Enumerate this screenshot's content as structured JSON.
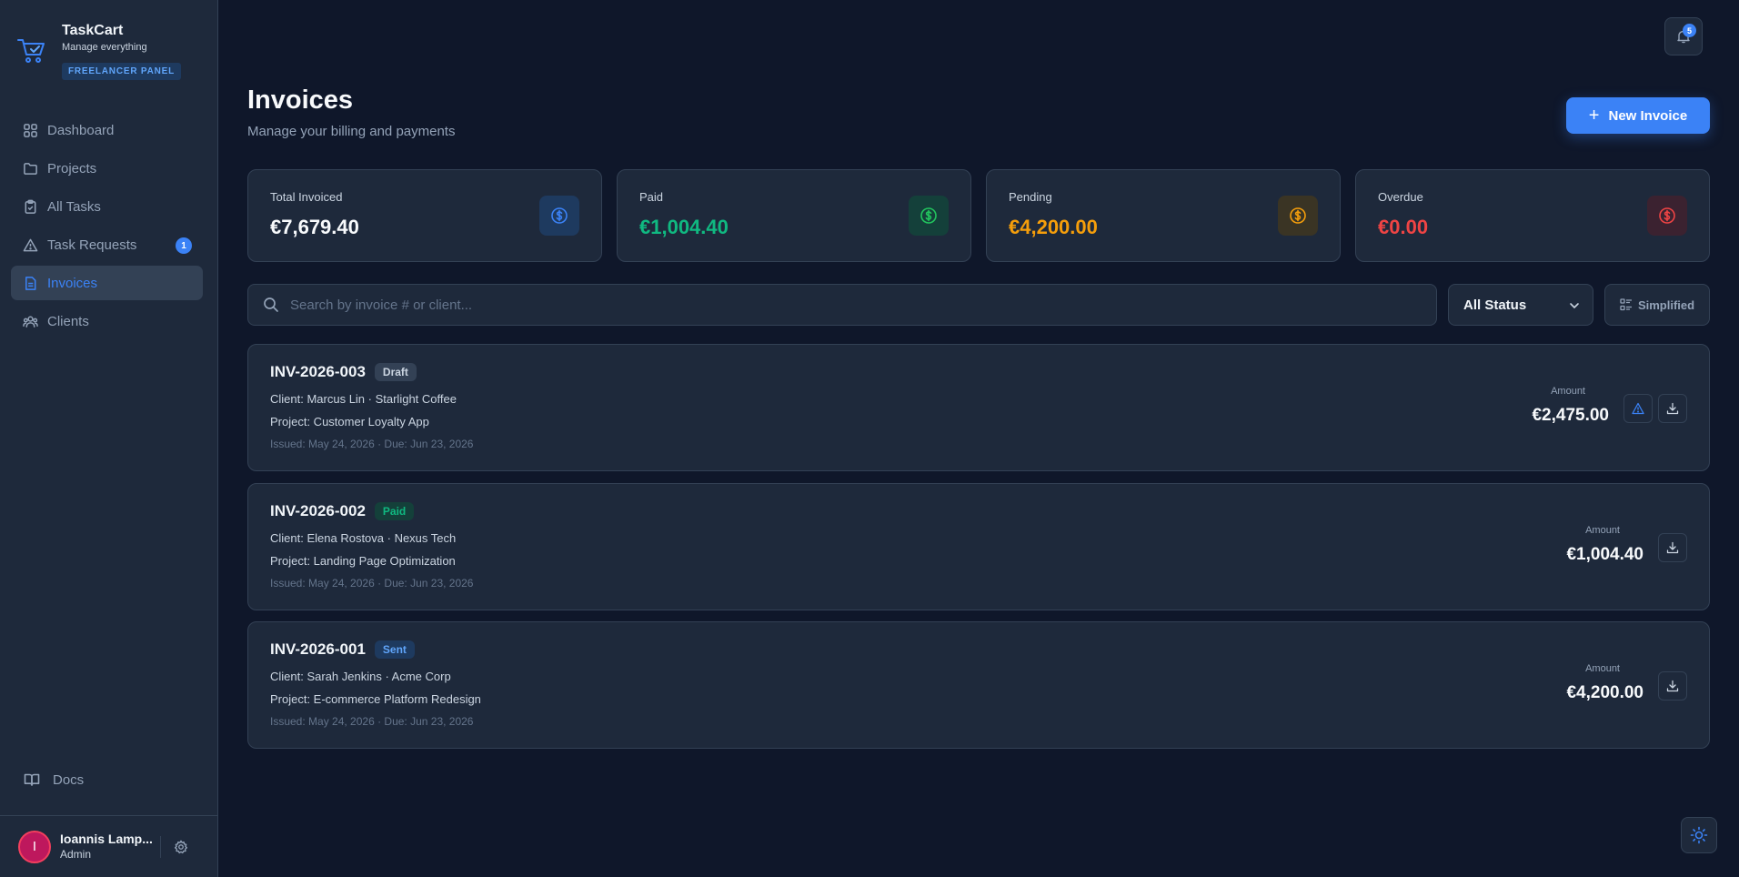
{
  "brand": {
    "name": "TaskCart",
    "tagline": "Manage everything",
    "panel_badge": "FREELANCER PANEL"
  },
  "sidebar": {
    "items": [
      {
        "label": "Dashboard",
        "icon": "grid-icon"
      },
      {
        "label": "Projects",
        "icon": "folder-icon"
      },
      {
        "label": "All Tasks",
        "icon": "clipboard-icon"
      },
      {
        "label": "Task Requests",
        "icon": "warning-triangle-icon",
        "badge": "1"
      },
      {
        "label": "Invoices",
        "icon": "file-icon",
        "active": true
      },
      {
        "label": "Clients",
        "icon": "users-icon"
      }
    ],
    "docs_label": "Docs"
  },
  "user": {
    "initial": "I",
    "name": "Ioannis Lamp...",
    "role": "Admin"
  },
  "header": {
    "notification_count": "5"
  },
  "page": {
    "title": "Invoices",
    "subtitle": "Manage your billing and payments",
    "new_button": "New Invoice"
  },
  "stats": [
    {
      "label": "Total Invoiced",
      "value": "€7,679.40",
      "color": "#f8fafc",
      "icon_color": "#3b82f6",
      "icon_bg": "#1e3a5f"
    },
    {
      "label": "Paid",
      "value": "€1,004.40",
      "color": "#10b981",
      "icon_color": "#22c55e",
      "icon_bg": "#14403a"
    },
    {
      "label": "Pending",
      "value": "€4,200.00",
      "color": "#f59e0b",
      "icon_color": "#f59e0b",
      "icon_bg": "#3a3424"
    },
    {
      "label": "Overdue",
      "value": "€0.00",
      "color": "#ef4444",
      "icon_color": "#ef4444",
      "icon_bg": "#3b2230"
    }
  ],
  "toolbar": {
    "search_placeholder": "Search by invoice # or client...",
    "status_filter": "All Status",
    "view_toggle": "Simplified"
  },
  "invoices": [
    {
      "number": "INV-2026-003",
      "status": "Draft",
      "status_bg": "#334155",
      "status_color": "#cbd5e1",
      "client": "Client: Marcus Lin · Starlight Coffee",
      "project": "Project: Customer Loyalty App",
      "dates": "Issued: May 24, 2026 · Due: Jun 23, 2026",
      "amount_label": "Amount",
      "amount": "€2,475.00",
      "has_warning": true
    },
    {
      "number": "INV-2026-002",
      "status": "Paid",
      "status_bg": "#14403a",
      "status_color": "#10b981",
      "client": "Client: Elena Rostova · Nexus Tech",
      "project": "Project: Landing Page Optimization",
      "dates": "Issued: May 24, 2026 · Due: Jun 23, 2026",
      "amount_label": "Amount",
      "amount": "€1,004.40",
      "has_warning": false
    },
    {
      "number": "INV-2026-001",
      "status": "Sent",
      "status_bg": "#1e3a5f",
      "status_color": "#60a5fa",
      "client": "Client: Sarah Jenkins · Acme Corp",
      "project": "Project: E-commerce Platform Redesign",
      "dates": "Issued: May 24, 2026 · Due: Jun 23, 2026",
      "amount_label": "Amount",
      "amount": "€4,200.00",
      "has_warning": false
    }
  ]
}
